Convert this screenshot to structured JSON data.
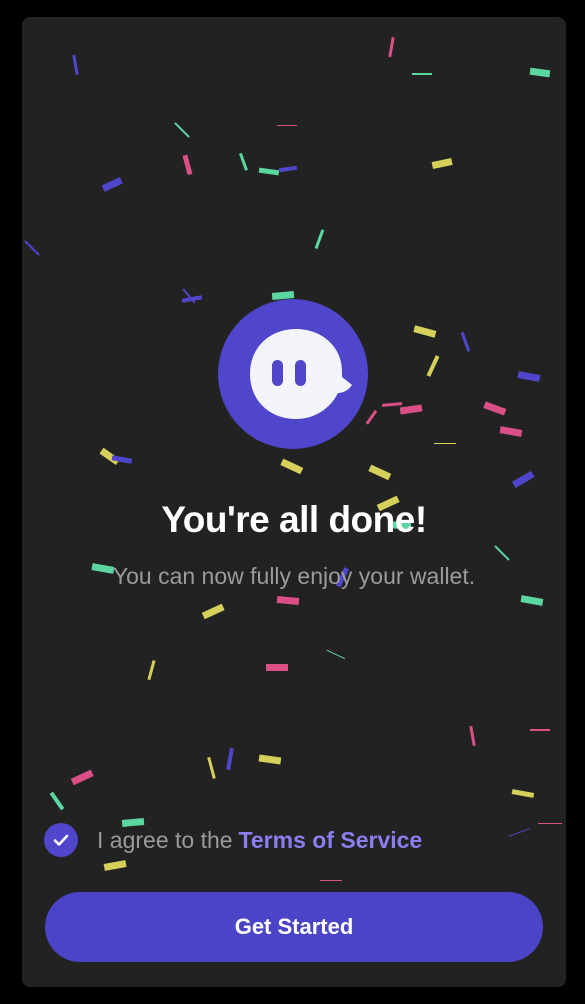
{
  "onboarding": {
    "title": "You're all done!",
    "subtitle": "You can now fully enjoy your wallet.",
    "agree_prefix": "I agree to the",
    "terms_link": "Terms of Service",
    "terms_checked": true,
    "cta_label": "Get Started"
  },
  "icons": {
    "logo": "ghost-icon",
    "check": "checkmark-icon"
  },
  "colors": {
    "background": "#222222",
    "accent": "#4b44c6",
    "link": "#8a7ef0",
    "confetti": [
      "#5046cc",
      "#d4d05a",
      "#5bd6a0",
      "#d94f86"
    ]
  }
}
